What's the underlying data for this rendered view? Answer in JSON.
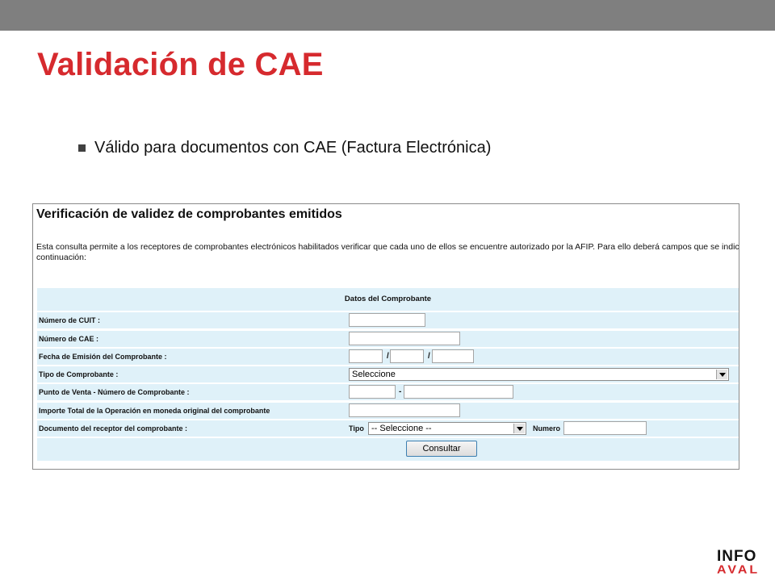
{
  "slide": {
    "title": "Validación de CAE",
    "bullet": "Válido para documentos con CAE (Factura Electrónica)"
  },
  "screenshot": {
    "heading": "Verificación de validez de comprobantes emitidos",
    "description": "Esta consulta permite a los receptores de comprobantes electrónicos habilitados verificar que cada uno de ellos se encuentre autorizado por la AFIP. Para ello deberá campos que se indican a continuación:",
    "form_header": "Datos del Comprobante",
    "fields": {
      "cuit_label": "Número de CUIT :",
      "cae_label": "Número de CAE :",
      "fecha_label": "Fecha de Emisión del Comprobante :",
      "fecha_sep": "/",
      "tipo_label": "Tipo de Comprobante :",
      "tipo_selected": "Seleccione",
      "punto_label": "Punto de Venta - Número de Comprobante :",
      "punto_sep": "-",
      "importe_label": "Importe Total de la Operación en moneda original del comprobante",
      "documento_label": "Documento del receptor del comprobante :",
      "doc_tipo_label": "Tipo",
      "doc_tipo_selected": "-- Seleccione --",
      "doc_numero_label": "Numero"
    },
    "submit_label": "Consultar"
  },
  "logo": {
    "top": "INFO",
    "bottom": "AVAL"
  },
  "colors": {
    "accent": "#d62a2e",
    "form_bg": "#dff1f9",
    "top_bar": "#7f7f7f"
  }
}
